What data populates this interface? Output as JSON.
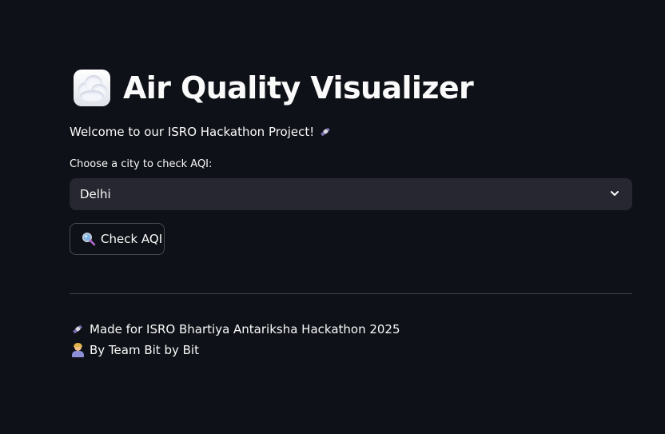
{
  "app": {
    "title": "Air Quality Visualizer",
    "title_icon": "cloud-icon",
    "welcome_text": "Welcome to our ISRO Hackathon Project!",
    "welcome_icon": "satellite-icon"
  },
  "city_select": {
    "label": "Choose a city to check AQI:",
    "selected_value": "Delhi",
    "icon": "chevron-down-icon"
  },
  "check_button": {
    "label": "Check AQI",
    "icon": "magnifier-icon"
  },
  "footer": {
    "line1": {
      "icon": "satellite-icon",
      "text": "Made for ISRO Bhartiya Antariksha Hackathon 2025"
    },
    "line2": {
      "icon": "technologist-icon",
      "text": "By Team Bit by Bit"
    }
  },
  "colors": {
    "background": "#0e1117",
    "text": "#fafafa",
    "select_background": "#262730"
  }
}
